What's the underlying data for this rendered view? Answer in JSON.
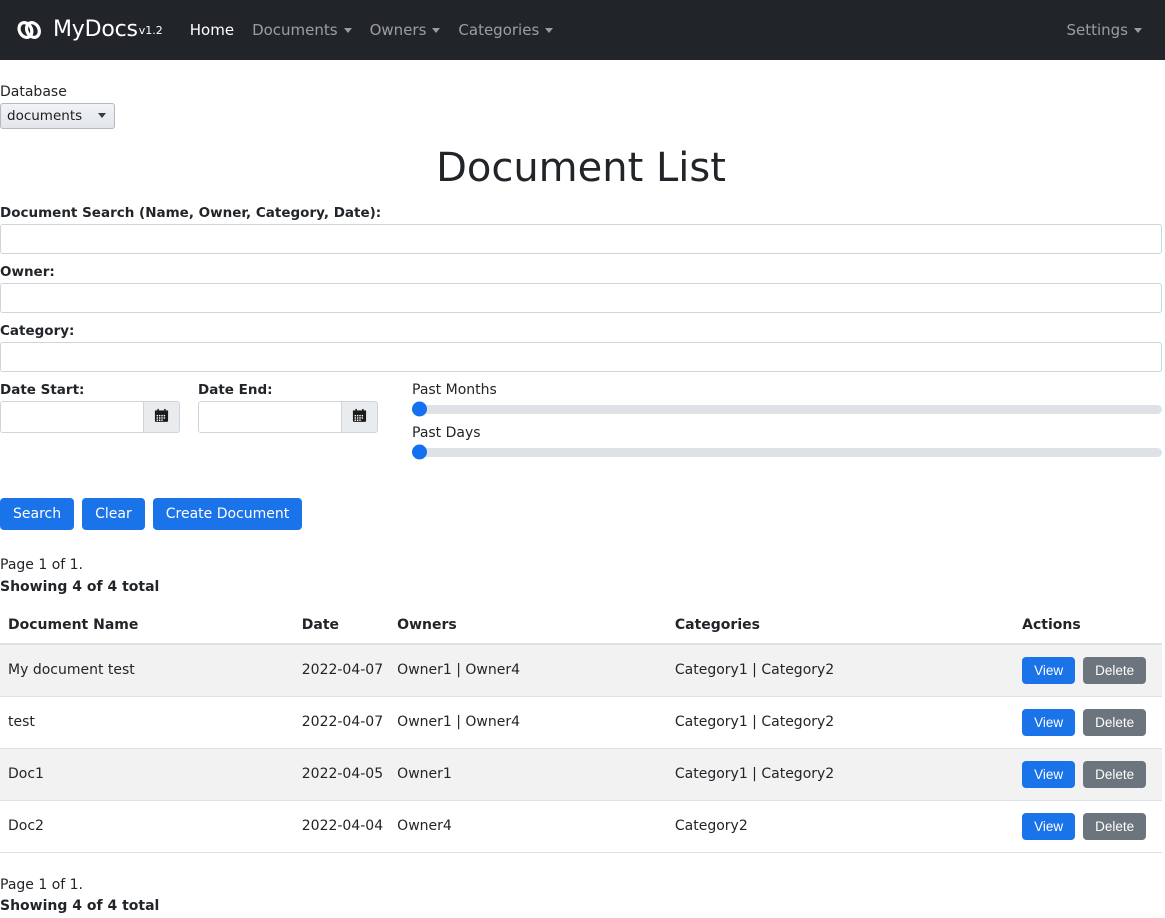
{
  "navbar": {
    "brand": "MyDocs",
    "version": "v1.2",
    "logo_icon": "chain-link-icon",
    "links": [
      {
        "label": "Home",
        "active": true,
        "has_caret": false
      },
      {
        "label": "Documents",
        "active": false,
        "has_caret": true
      },
      {
        "label": "Owners",
        "active": false,
        "has_caret": true
      },
      {
        "label": "Categories",
        "active": false,
        "has_caret": true
      }
    ],
    "right": {
      "label": "Settings",
      "has_caret": true
    },
    "bg_color": "#212529"
  },
  "database": {
    "label": "Database",
    "selected": "documents",
    "options": [
      "documents"
    ]
  },
  "page_title": "Document List",
  "filters": {
    "search_label": "Document Search (Name, Owner, Category, Date):",
    "search_value": "",
    "search_placeholder": "",
    "owner_label": "Owner:",
    "owner_value": "",
    "owner_placeholder": "",
    "category_label": "Category:",
    "category_value": "",
    "category_placeholder": "",
    "date_start_label": "Date Start:",
    "date_start_value": "",
    "date_end_label": "Date End:",
    "date_end_value": "",
    "calendar_icon": "calendar-icon",
    "past_months_label": "Past Months",
    "past_months_value": 0,
    "past_days_label": "Past Days",
    "past_days_value": 0,
    "slider_accent": "#146ff1"
  },
  "buttons": {
    "search": "Search",
    "clear": "Clear",
    "create": "Create Document",
    "primary_color": "#1a73e8",
    "secondary_color": "#6c757d"
  },
  "pager_top": {
    "page_text": "Page 1 of 1.",
    "showing_text": "Showing 4 of 4 total"
  },
  "pager_bottom": {
    "page_text": "Page 1 of 1.",
    "showing_text": "Showing 4 of 4 total"
  },
  "table": {
    "headers": {
      "name": "Document Name",
      "date": "Date",
      "owners": "Owners",
      "categories": "Categories",
      "actions": "Actions"
    },
    "row_actions": {
      "view": "View",
      "delete": "Delete"
    },
    "rows": [
      {
        "name": "My document test",
        "date": "2022-04-07",
        "owners": "Owner1 | Owner4",
        "categories": "Category1 | Category2"
      },
      {
        "name": "test",
        "date": "2022-04-07",
        "owners": "Owner1 | Owner4",
        "categories": "Category1 | Category2"
      },
      {
        "name": "Doc1",
        "date": "2022-04-05",
        "owners": "Owner1",
        "categories": "Category1 | Category2"
      },
      {
        "name": "Doc2",
        "date": "2022-04-04",
        "owners": "Owner4",
        "categories": "Category2"
      }
    ]
  }
}
